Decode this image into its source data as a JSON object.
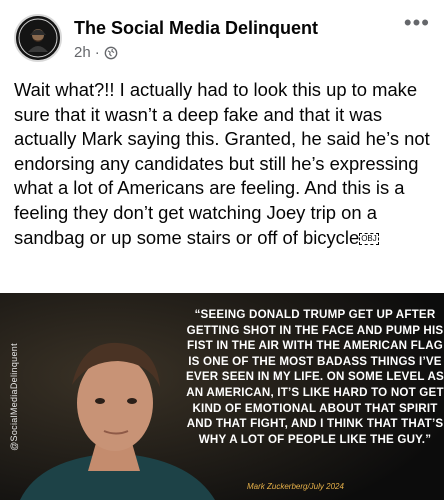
{
  "post": {
    "page_name": "The Social Media Delinquent",
    "time": "2h",
    "time_dot": "·",
    "more_label": "•••",
    "text": "Wait what?!! I actually had to look this up to make sure that it wasn’t a deep fake and that it was actually Mark saying this. Granted, he said he’s not endorsing any candidates but still he’s expressing what a lot of Americans are feeling. And this is a feeling they don’t get watching Joey trip on a sandbag or up some stairs or off of bicycle",
    "obj_placeholder": "OBJ"
  },
  "image": {
    "quote": "“Seeing Donald Trump get up after getting shot in the face and pump his fist in the air with the American flag is one of the most badass things I’ve ever seen in my life. On some level as an American, it’s like hard to not get kind of emotional about that spirit and that fight, and I think that that’s why a lot of people like the guy.”",
    "attribution": "Mark Zuckerberg/July 2024",
    "watermark": "@SocialMediaDelinquent"
  },
  "colors": {
    "text": "#050505",
    "secondary": "#65676b",
    "quote_text": "#ffffff",
    "attribution": "#e8b24a"
  }
}
